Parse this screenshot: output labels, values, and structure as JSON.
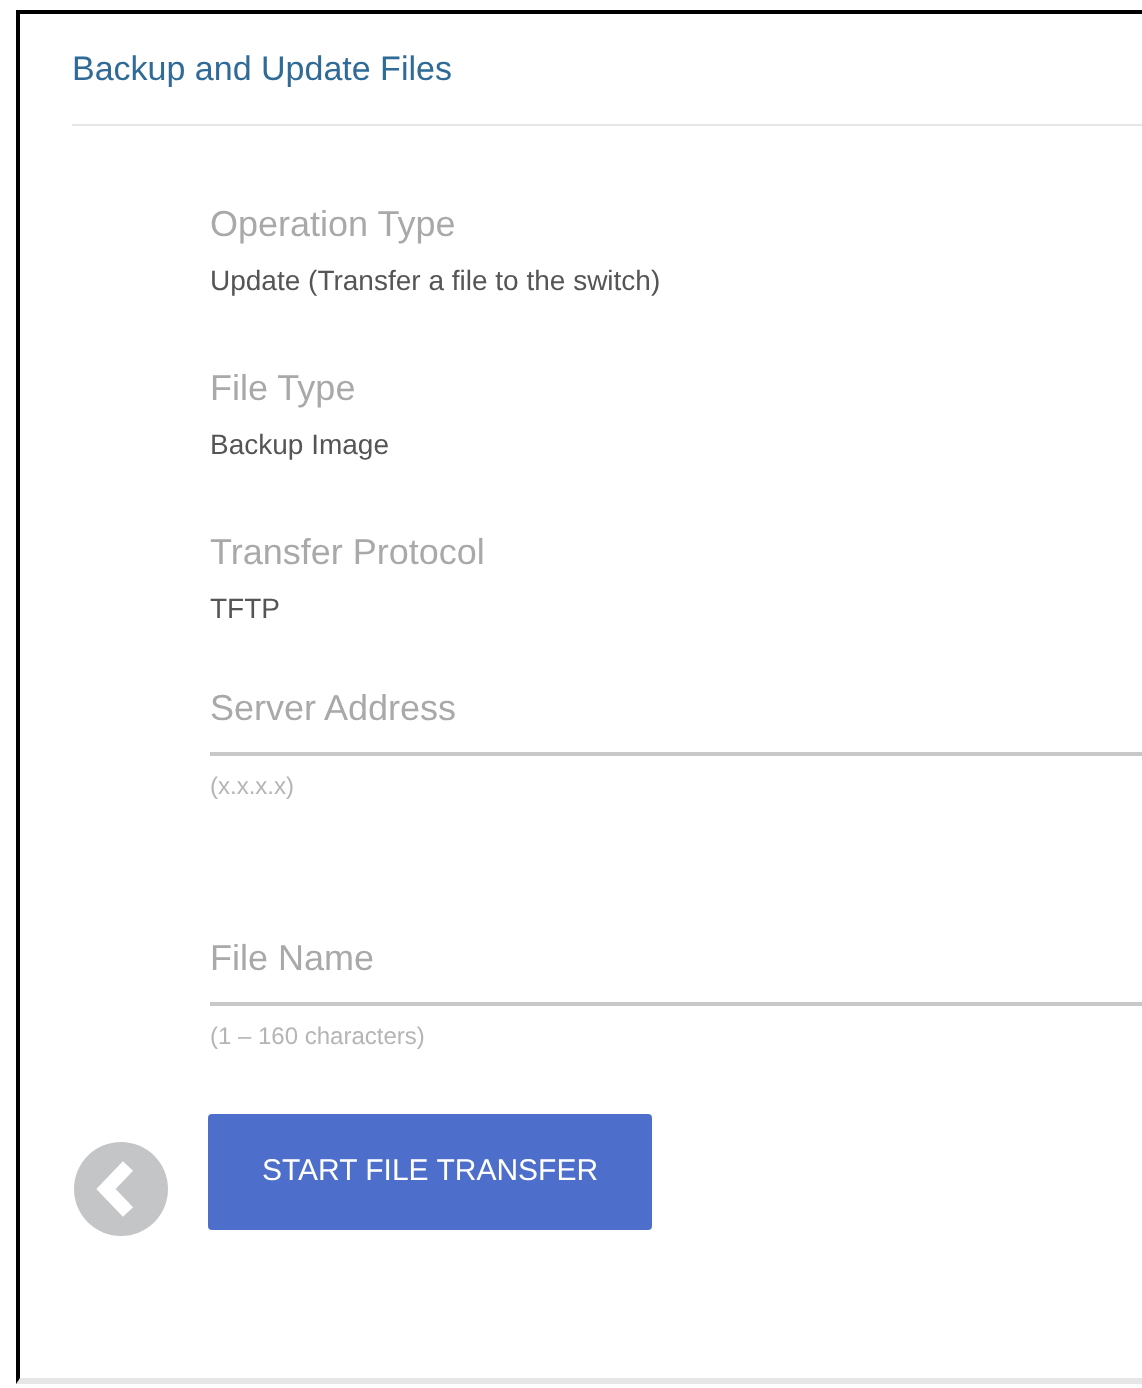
{
  "panel": {
    "title": "Backup and Update Files"
  },
  "info": [
    {
      "label": "Operation Type",
      "value": "Update (Transfer a file to the switch)"
    },
    {
      "label": "File Type",
      "value": "Backup Image"
    },
    {
      "label": "Transfer Protocol",
      "value": "TFTP"
    }
  ],
  "inputs": [
    {
      "placeholder": "Server Address",
      "hint": "(x.x.x.x)"
    },
    {
      "placeholder": "File Name",
      "hint": "(1 – 160 characters)"
    }
  ],
  "button": {
    "label": "START FILE TRANSFER"
  }
}
